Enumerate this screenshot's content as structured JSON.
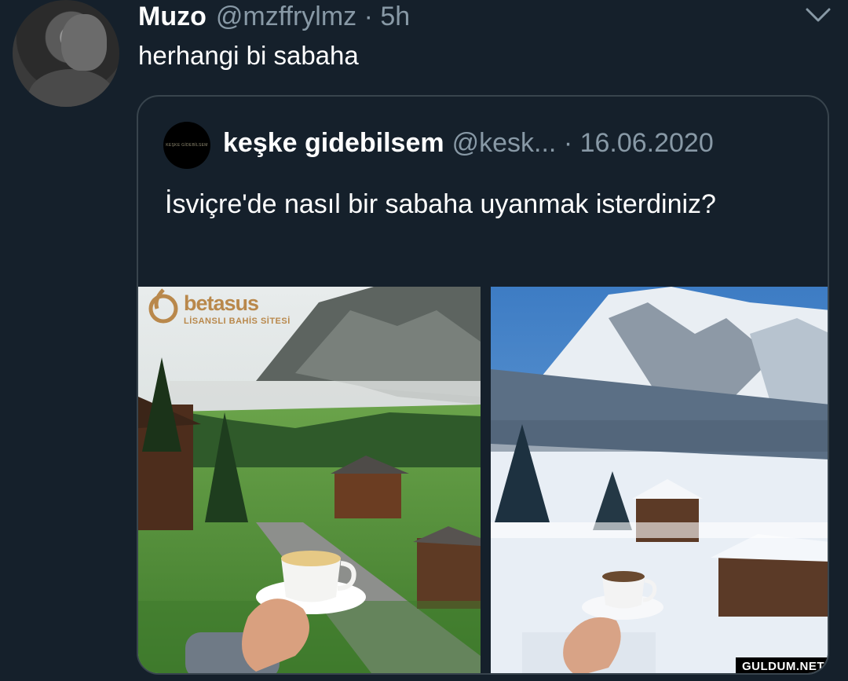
{
  "tweet": {
    "display_name": "Muzo",
    "handle_time": "@mzffrylmz · 5h",
    "text": "herhangi bi sabaha"
  },
  "quoted_tweet": {
    "avatar_text": "KEŞKE GİDEBİLSEM",
    "display_name": "keşke gidebilsem",
    "handle_date": "@kesk... · 16.06.2020",
    "text": "İsviçre'de nasıl bir sabaha uyanmak isterdiniz?",
    "photos": [
      "summer-village-coffee",
      "winter-village-coffee"
    ]
  },
  "watermark": {
    "brand": "betasus",
    "tagline": "LİSANSLI BAHİS SİTESİ"
  },
  "site_badge": "GULDUM.NET",
  "colors": {
    "background": "#15202b",
    "secondary_text": "#8899a6",
    "border": "#38444d"
  }
}
